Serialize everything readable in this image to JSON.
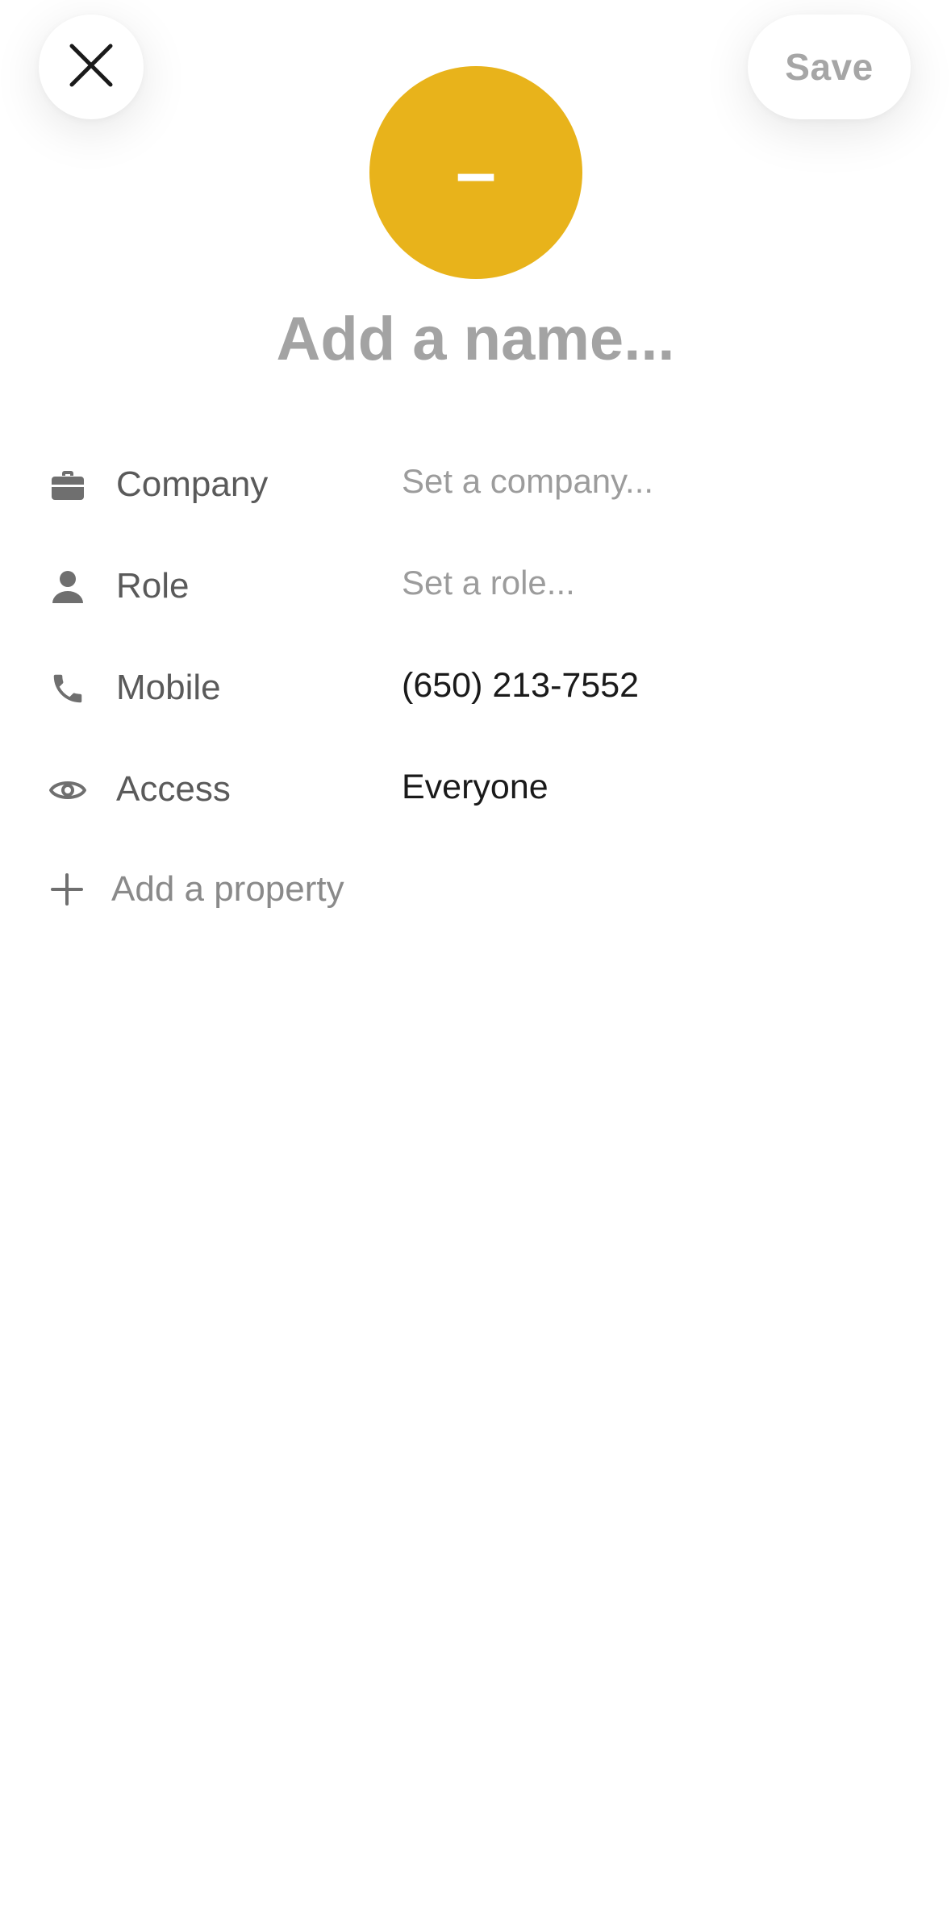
{
  "header": {
    "close_icon": "close-icon",
    "save_label": "Save"
  },
  "avatar": {
    "initial": "–",
    "color": "#E8B31B"
  },
  "name": {
    "placeholder": "Add a name...",
    "value": ""
  },
  "properties": [
    {
      "icon": "briefcase-icon",
      "label": "Company",
      "placeholder": "Set a company...",
      "value": ""
    },
    {
      "icon": "person-icon",
      "label": "Role",
      "placeholder": "Set a role...",
      "value": ""
    },
    {
      "icon": "phone-icon",
      "label": "Mobile",
      "value": "(650) 213-7552"
    },
    {
      "icon": "eye-icon",
      "label": "Access",
      "value": "Everyone"
    }
  ],
  "add_property": {
    "icon": "plus-icon",
    "label": "Add a property"
  },
  "colors": {
    "icon_gray": "#6f6f6f",
    "placeholder_gray": "#9c9c9c",
    "text_dark": "#1a1a1a"
  }
}
